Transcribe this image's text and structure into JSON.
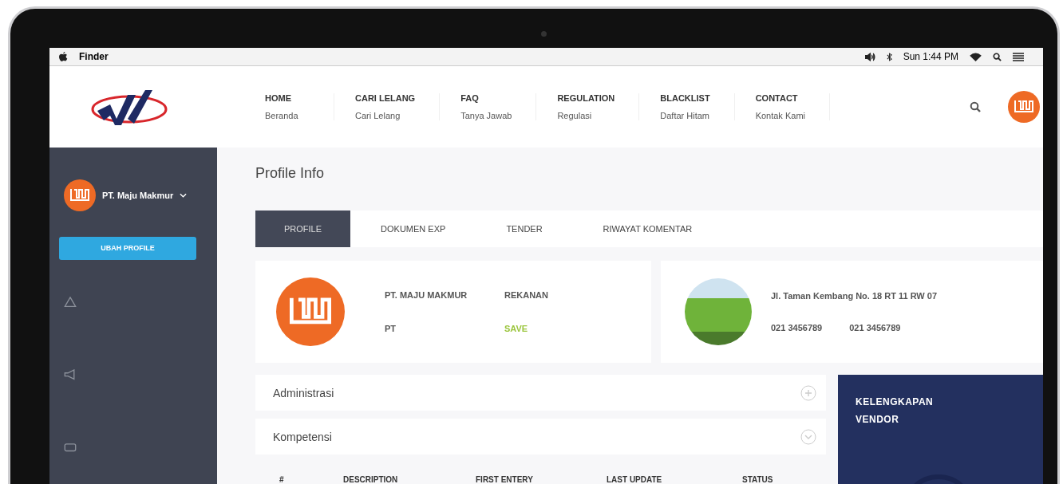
{
  "menu_bar": {
    "app": "Finder",
    "clock": "Sun 1:44 PM"
  },
  "nav": [
    {
      "title": "HOME",
      "subtitle": "Beranda"
    },
    {
      "title": "CARI LELANG",
      "subtitle": "Cari Lelang"
    },
    {
      "title": "FAQ",
      "subtitle": "Tanya Jawab"
    },
    {
      "title": "REGULATION",
      "subtitle": "Regulasi"
    },
    {
      "title": "BLACKLIST",
      "subtitle": "Daftar Hitam"
    },
    {
      "title": "CONTACT",
      "subtitle": "Kontak Kami"
    }
  ],
  "sidebar": {
    "user_name": "PT. Maju Makmur",
    "button": "UBAH PROFILE"
  },
  "page": {
    "title": "Profile Info",
    "tabs": [
      {
        "label": "PROFILE",
        "selected": true
      },
      {
        "label": "DOKUMEN EXP",
        "selected": false
      },
      {
        "label": "TENDER",
        "selected": false
      },
      {
        "label": "RIWAYAT KOMENTAR",
        "selected": false
      }
    ],
    "profile_fields": [
      {
        "value": "PT. MAJU MAKMUR",
        "kind": "text"
      },
      {
        "value": "REKANAN",
        "kind": "text"
      },
      {
        "value": "PT",
        "kind": "text"
      },
      {
        "value": "SAVE",
        "kind": "status"
      }
    ],
    "address": "Jl. Taman Kembang No. 18 RT 11 RW 07",
    "phones": [
      "021 3456789",
      "021 3456789"
    ],
    "sections": [
      {
        "title": "Administrasi",
        "expanded": false
      },
      {
        "title": "Kompetensi",
        "expanded": true
      }
    ],
    "table": {
      "columns": [
        "#",
        "DESCRIPTION",
        "FIRST ENTERY",
        "LAST UPDATE",
        "STATUS"
      ]
    },
    "vendor_panel": {
      "title": "KELENGKAPAN VENDOR"
    }
  }
}
